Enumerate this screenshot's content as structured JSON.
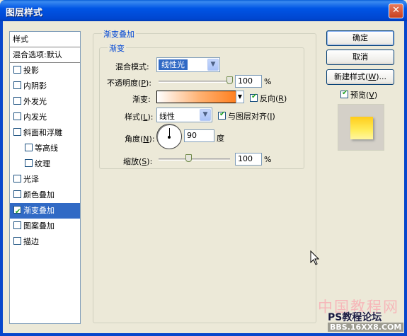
{
  "window": {
    "title": "图层样式",
    "close_glyph": "✕"
  },
  "style_list": {
    "header": "样式",
    "blend_default": "混合选项:默认",
    "items": [
      {
        "label": "投影",
        "checked": false,
        "indent": false
      },
      {
        "label": "内阴影",
        "checked": false,
        "indent": false
      },
      {
        "label": "外发光",
        "checked": false,
        "indent": false
      },
      {
        "label": "内发光",
        "checked": false,
        "indent": false
      },
      {
        "label": "斜面和浮雕",
        "checked": false,
        "indent": false
      },
      {
        "label": "等高线",
        "checked": false,
        "indent": true
      },
      {
        "label": "纹理",
        "checked": false,
        "indent": true
      },
      {
        "label": "光泽",
        "checked": false,
        "indent": false
      },
      {
        "label": "颜色叠加",
        "checked": false,
        "indent": false
      },
      {
        "label": "渐变叠加",
        "checked": true,
        "indent": false,
        "selected": true
      },
      {
        "label": "图案叠加",
        "checked": false,
        "indent": false
      },
      {
        "label": "描边",
        "checked": false,
        "indent": false
      }
    ]
  },
  "panel": {
    "outer_title": "渐变叠加",
    "inner_title": "渐变",
    "blend_mode_label": "混合模式:",
    "blend_mode_value": "线性光",
    "opacity_label": "不透明度",
    "opacity_key": "P",
    "opacity_value": "100",
    "opacity_level": 1.0,
    "percent": "%",
    "gradient_label": "渐变:",
    "reverse_label": "反向",
    "reverse_key": "R",
    "reverse_checked": true,
    "style_label": "样式",
    "style_key": "L",
    "style_value": "线性",
    "align_label": "与图层对齐",
    "align_key": "I",
    "align_checked": true,
    "angle_label": "角度",
    "angle_key": "N",
    "angle_value": "90",
    "degree": "度",
    "scale_label": "缩放",
    "scale_key": "S",
    "scale_value": "100",
    "scale_level": 0.43
  },
  "buttons": {
    "ok": "确定",
    "cancel": "取消",
    "new_style": "新建样式",
    "new_style_key": "W",
    "preview_label": "预览",
    "preview_key": "V",
    "preview_checked": true
  },
  "watermark": {
    "line1": "中国教程网",
    "line2": "PS教程论坛",
    "line3": "BBS.16XX8.COM"
  },
  "colors": {
    "selection": "#316ac5",
    "legend_blue": "#0046d5",
    "gradient_start": "#ffffff",
    "gradient_end": "#ff8020"
  }
}
